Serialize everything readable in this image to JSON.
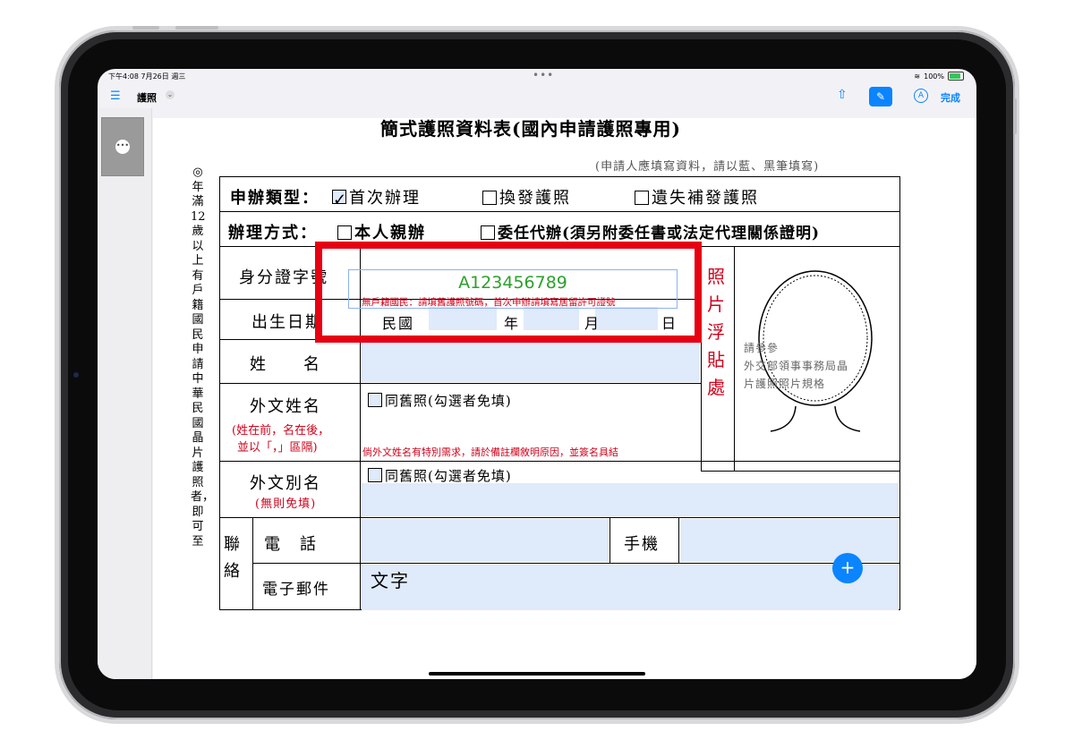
{
  "status_bar": {
    "time": "下午4:08  7月26日 週三",
    "wifi_icon": "wifi-icon",
    "battery": "100%"
  },
  "toolbar": {
    "doc_title": "護照",
    "done_label": "完成",
    "share_icon": "share-icon",
    "markup_icon": "markup-icon",
    "pen_icon": "pen-icon"
  },
  "document": {
    "title": "簡式護照資料表(國內申請護照專用)",
    "subtitle": "(申請人應填寫資料，請以藍、黑筆填寫)",
    "side_note": "◎年滿12歲以上有戶籍國民申請中華民國晶片護照者，即可至",
    "apply_type_label": "申辦類型：",
    "apply_options": [
      "首次辦理",
      "換發護照",
      "遺失補發護照"
    ],
    "method_label": "辦理方式：",
    "method_options": [
      "本人親辦",
      "委任代辦(須另附委任書或法定代理關係證明)"
    ],
    "id_label": "身分證字號",
    "id_value": "A123456789",
    "id_note": "無戶籍國民：請填舊護照號碼，首次申辦請填寫居留許可證號",
    "birth_label": "出生日期",
    "birth_parts": [
      "民國",
      "年",
      "月",
      "日"
    ],
    "name_label": "姓　　名",
    "foreign_name_label": "外文姓名",
    "foreign_name_note1": "(姓在前，名在後，",
    "foreign_name_note2": "並以「，」區隔)",
    "same_old_passport": "同舊照(勾選者免填)",
    "foreign_name_special": "倘外文姓名有特別需求，請於備註欄敘明原因，並簽名具結",
    "foreign_alias_label": "外文別名",
    "foreign_alias_note": "(無則免填)",
    "photo_label": "照片浮貼處",
    "photo_ref": [
      "請參參",
      "外交部領事事務局晶",
      "片護照照片規格"
    ],
    "contact_label": "聯絡",
    "phone_label": "電　話",
    "mobile_label": "手機",
    "email_label": "電子郵件",
    "text_annotation": "文字"
  },
  "colors": {
    "accent": "#0a84ff",
    "highlight": "#e60012",
    "field_fill": "#dfeafb",
    "green_text": "#2ca02c"
  }
}
